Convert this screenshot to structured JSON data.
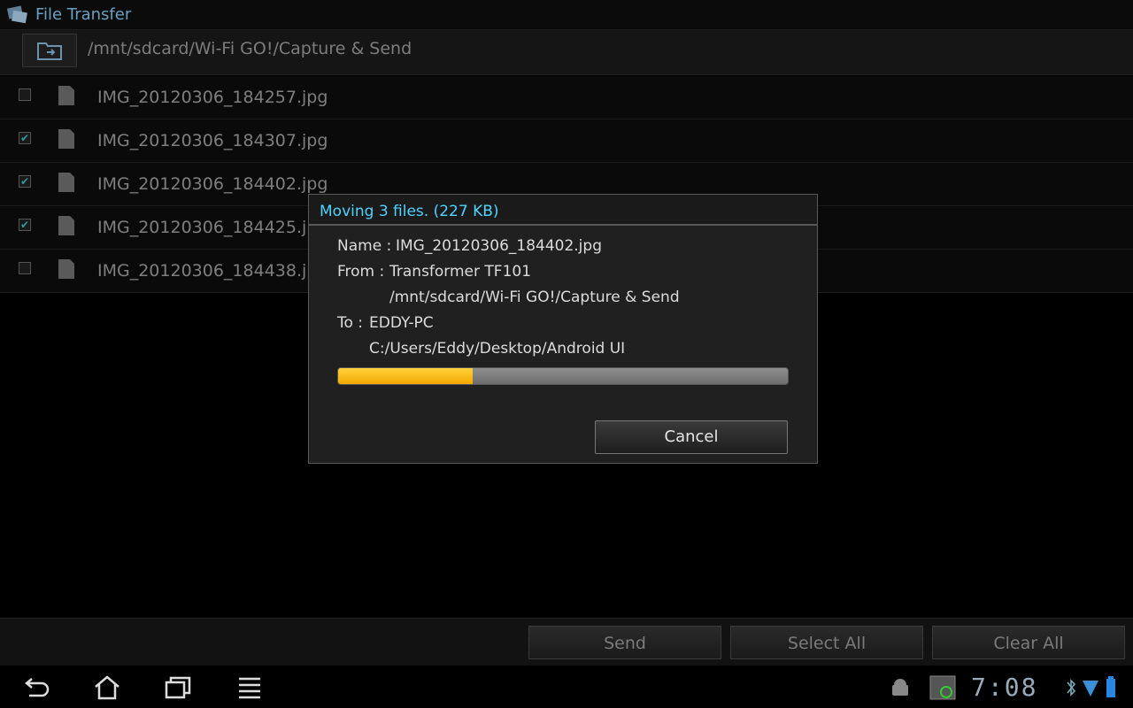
{
  "app": {
    "title": "File Transfer"
  },
  "path": {
    "current": "/mnt/sdcard/Wi-Fi GO!/Capture & Send"
  },
  "files": [
    {
      "name": "IMG_20120306_184257.jpg",
      "checked": false
    },
    {
      "name": "IMG_20120306_184307.jpg",
      "checked": true
    },
    {
      "name": "IMG_20120306_184402.jpg",
      "checked": true
    },
    {
      "name": "IMG_20120306_184425.jpg",
      "checked": true
    },
    {
      "name": "IMG_20120306_184438.jpg",
      "checked": false
    }
  ],
  "toolbar": {
    "send": "Send",
    "select_all": "Select All",
    "clear_all": "Clear All"
  },
  "dialog": {
    "title": "Moving 3 files. (227 KB)",
    "name_label": "Name :",
    "name_value": "IMG_20120306_184402.jpg",
    "from_label": "From :",
    "from_device": "Transformer TF101",
    "from_path": "/mnt/sdcard/Wi-Fi GO!/Capture & Send",
    "to_label": "To :",
    "to_device": "EDDY-PC",
    "to_path": "C:/Users/Eddy/Desktop/Android UI",
    "progress_percent": 30,
    "cancel": "Cancel"
  },
  "statusbar": {
    "time": "7:08"
  },
  "colors": {
    "accent": "#4fd3ff",
    "progress": "#f4b400"
  }
}
